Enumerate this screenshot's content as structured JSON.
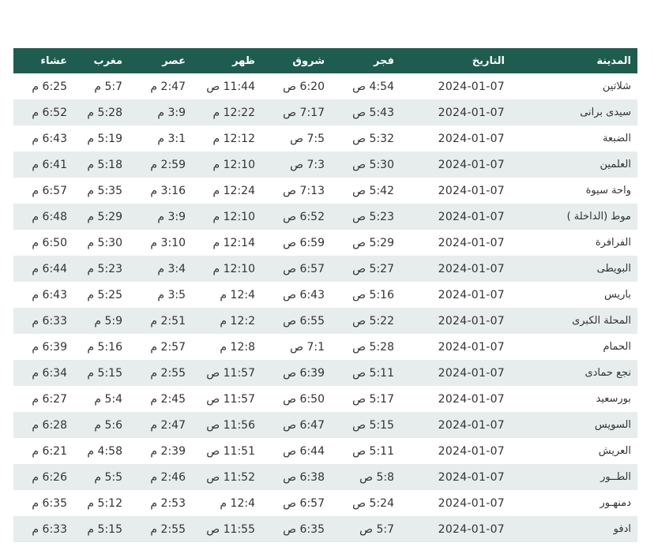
{
  "header": {
    "city": "المدينة",
    "date": "التاريخ",
    "fajr": "فجر",
    "sunrise": "شروق",
    "dhuhr": "ظهر",
    "asr": "عصر",
    "maghrib": "مغرب",
    "isha": "عشاء"
  },
  "rows": [
    {
      "city": "شلاتين",
      "date": "2024-01-07",
      "fajr": "4:54 ص",
      "sunrise": "6:20 ص",
      "dhuhr": "11:44 ص",
      "asr": "2:47 م",
      "maghrib": "5:7 م",
      "isha": "6:25 م"
    },
    {
      "city": "سيدى برانى",
      "date": "2024-01-07",
      "fajr": "5:43 ص",
      "sunrise": "7:17 ص",
      "dhuhr": "12:22 م",
      "asr": "3:9 م",
      "maghrib": "5:28 م",
      "isha": "6:52 م"
    },
    {
      "city": "الضبعة",
      "date": "2024-01-07",
      "fajr": "5:32 ص",
      "sunrise": "7:5 ص",
      "dhuhr": "12:12 م",
      "asr": "3:1 م",
      "maghrib": "5:19 م",
      "isha": "6:43 م"
    },
    {
      "city": "العلمين",
      "date": "2024-01-07",
      "fajr": "5:30 ص",
      "sunrise": "7:3 ص",
      "dhuhr": "12:10 م",
      "asr": "2:59 م",
      "maghrib": "5:18 م",
      "isha": "6:41 م"
    },
    {
      "city": "واحة سيوة",
      "date": "2024-01-07",
      "fajr": "5:42 ص",
      "sunrise": "7:13 ص",
      "dhuhr": "12:24 م",
      "asr": "3:16 م",
      "maghrib": "5:35 م",
      "isha": "6:57 م"
    },
    {
      "city": "موط (الداخلة )",
      "date": "2024-01-07",
      "fajr": "5:23 ص",
      "sunrise": "6:52 ص",
      "dhuhr": "12:10 م",
      "asr": "3:9 م",
      "maghrib": "5:29 م",
      "isha": "6:48 م"
    },
    {
      "city": "الفرافرة",
      "date": "2024-01-07",
      "fajr": "5:29 ص",
      "sunrise": "6:59 ص",
      "dhuhr": "12:14 م",
      "asr": "3:10 م",
      "maghrib": "5:30 م",
      "isha": "6:50 م"
    },
    {
      "city": "البويطى",
      "date": "2024-01-07",
      "fajr": "5:27 ص",
      "sunrise": "6:57 ص",
      "dhuhr": "12:10 م",
      "asr": "3:4 م",
      "maghrib": "5:23 م",
      "isha": "6:44 م"
    },
    {
      "city": "باريس",
      "date": "2024-01-07",
      "fajr": "5:16 ص",
      "sunrise": "6:43 ص",
      "dhuhr": "12:4 م",
      "asr": "3:5 م",
      "maghrib": "5:25 م",
      "isha": "6:43 م"
    },
    {
      "city": "المحلة الكبرى",
      "date": "2024-01-07",
      "fajr": "5:22 ص",
      "sunrise": "6:55 ص",
      "dhuhr": "12:2 م",
      "asr": "2:51 م",
      "maghrib": "5:9 م",
      "isha": "6:33 م"
    },
    {
      "city": "الحمام",
      "date": "2024-01-07",
      "fajr": "5:28 ص",
      "sunrise": "7:1 ص",
      "dhuhr": "12:8 م",
      "asr": "2:57 م",
      "maghrib": "5:16 م",
      "isha": "6:39 م"
    },
    {
      "city": "نجع حمادى",
      "date": "2024-01-07",
      "fajr": "5:11 ص",
      "sunrise": "6:39 ص",
      "dhuhr": "11:57 ص",
      "asr": "2:55 م",
      "maghrib": "5:15 م",
      "isha": "6:34 م"
    },
    {
      "city": "بورسعيد",
      "date": "2024-01-07",
      "fajr": "5:17 ص",
      "sunrise": "6:50 ص",
      "dhuhr": "11:57 ص",
      "asr": "2:45 م",
      "maghrib": "5:4 م",
      "isha": "6:27 م"
    },
    {
      "city": "السويس",
      "date": "2024-01-07",
      "fajr": "5:15 ص",
      "sunrise": "6:47 ص",
      "dhuhr": "11:56 ص",
      "asr": "2:47 م",
      "maghrib": "5:6 م",
      "isha": "6:28 م"
    },
    {
      "city": "العريش",
      "date": "2024-01-07",
      "fajr": "5:11 ص",
      "sunrise": "6:44 ص",
      "dhuhr": "11:51 ص",
      "asr": "2:39 م",
      "maghrib": "4:58 م",
      "isha": "6:21 م"
    },
    {
      "city": "الطــور",
      "date": "2024-01-07",
      "fajr": "5:8 ص",
      "sunrise": "6:38 ص",
      "dhuhr": "11:52 ص",
      "asr": "2:46 م",
      "maghrib": "5:5 م",
      "isha": "6:26 م"
    },
    {
      "city": "دمنهـور",
      "date": "2024-01-07",
      "fajr": "5:24 ص",
      "sunrise": "6:57 ص",
      "dhuhr": "12:4 م",
      "asr": "2:53 م",
      "maghrib": "5:12 م",
      "isha": "6:35 م"
    },
    {
      "city": "ادفو",
      "date": "2024-01-07",
      "fajr": "5:7 ص",
      "sunrise": "6:35 ص",
      "dhuhr": "11:55 ص",
      "asr": "2:55 م",
      "maghrib": "5:15 م",
      "isha": "6:33 م"
    }
  ]
}
